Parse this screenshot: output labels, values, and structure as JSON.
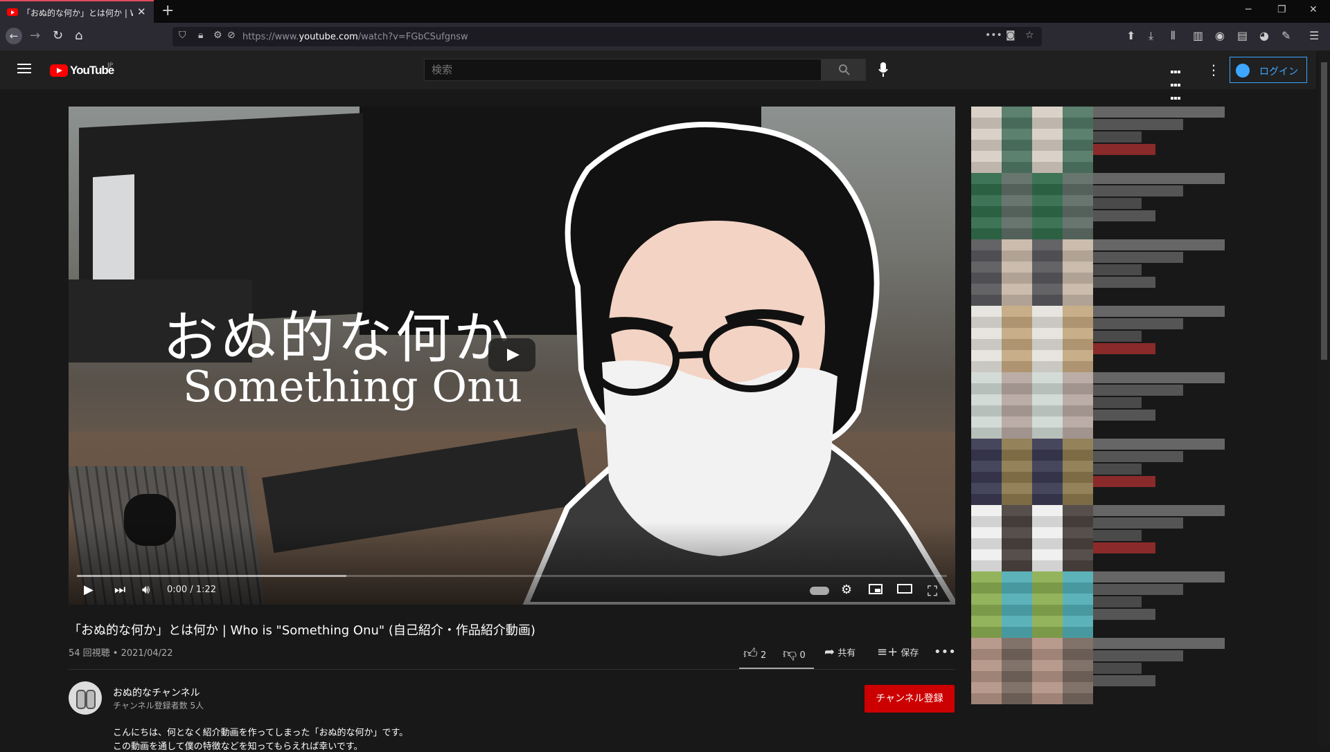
{
  "browser": {
    "tab_title": "「おぬ的な何か」とは何か | Who is \"Something Onu\"",
    "url_prefix": "https://www.",
    "url_domain": "youtube.com",
    "url_path": "/watch?v=FGbCSufgnsw"
  },
  "header": {
    "logo_text": "YouTube",
    "logo_region": "JP",
    "search_placeholder": "検索",
    "login_label": "ログイン"
  },
  "video": {
    "overlay_title_jp": "おぬ的な何か",
    "overlay_title_en": "Something Onu",
    "time": "0:00 / 1:22",
    "progress_loaded": 0.31
  },
  "info": {
    "title": "「おぬ的な何か」とは何か | Who is \"Something Onu\" (自己紹介・作品紹介動画)",
    "views_date": "54 回視聴 • 2021/04/22",
    "likes": "2",
    "dislikes": "0",
    "share_label": "共有",
    "save_label": "保存"
  },
  "channel": {
    "name": "おぬ的なチャンネル",
    "subscribers": "チャンネル登録者数 5人",
    "subscribe_label": "チャンネル登録"
  },
  "description": {
    "line1": "こんにちは、何となく紹介動画を作ってしまった「おぬ的な何か」です。",
    "line2": "この動画を通して僕の特徴などを知ってもらえれば幸いです。"
  },
  "colors": {
    "background": "#181818",
    "header": "#202020",
    "accent_red": "#cc0000",
    "link_blue": "#3ea6ff"
  },
  "sidebar_thumbs": [
    {
      "a": "#d9cfc4",
      "b": "#4f7a65",
      "meta_accent": "#8a2a2a"
    },
    {
      "a": "#2e6e4a",
      "b": "#5e6e66",
      "meta_accent": "#555555"
    },
    {
      "a": "#5a5a5e",
      "b": "#c9b8a6",
      "meta_accent": "#555555"
    },
    {
      "a": "#e6e3dc",
      "b": "#c8a97c",
      "meta_accent": "#8a2a2a"
    },
    {
      "a": "#cfd9d4",
      "b": "#b8a8a0",
      "meta_accent": "#555555"
    },
    {
      "a": "#3b3a55",
      "b": "#8f7a4a",
      "meta_accent": "#8a2a2a"
    },
    {
      "a": "#efefef",
      "b": "#4e4440",
      "meta_accent": "#8a2a2a"
    },
    {
      "a": "#8ab04a",
      "b": "#4ab0b8",
      "meta_accent": "#555555"
    },
    {
      "a": "#b89484",
      "b": "#7a6a60",
      "meta_accent": "#555555"
    }
  ]
}
